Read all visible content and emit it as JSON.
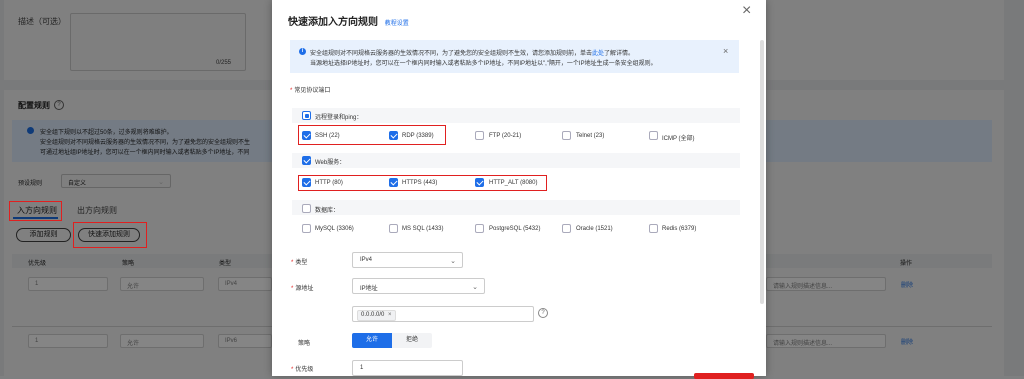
{
  "background": {
    "desc_label": "描述（可选）",
    "desc_counter": "0/255",
    "config_title": "配置规则",
    "info_lines": [
      "安全组下规则以不超过50条，过多规则将难维护。",
      "安全组规则对不同规格云服务器的生效情况不同，为了避免您的安全组规则不生",
      "可通过地址组IP地址时，您可以在一个框内同时输入或者粘贴多个IP地址，不同"
    ],
    "preset_label": "预设规则",
    "preset_value": "自定义",
    "tabs": [
      "入方向规则",
      "出方向规则"
    ],
    "add_rule": "添加规则",
    "quick_add_rule": "快速添加规则",
    "table_headers": [
      "优先级",
      "策略",
      "类型",
      "操作"
    ],
    "rows": [
      {
        "priority": "1",
        "policy": "允许",
        "type": "IPv4",
        "remark_placeholder": "请输入规则描述信息...",
        "action": "删除"
      },
      {
        "priority": "1",
        "policy": "允许",
        "type": "IPv6",
        "remark_placeholder": "请输入规则描述信息...",
        "action": "删除"
      }
    ]
  },
  "modal": {
    "title": "快速添加入方向规则",
    "title_link": "教程设置",
    "info": {
      "line1_prefix": "安全组规则对不同规格云服务器的生效情况不同，为了避免您的安全组规则不生效，请您添加规则前，单击",
      "line1_link": "此处",
      "line1_suffix": "了解详情。",
      "line2": "当源地址选择IP地址时，您可以在一个框内同时输入或者粘贴多个IP地址，不同IP地址以\",\"隔开，一个IP地址生成一条安全组规则。"
    },
    "protocols_label": "常见协议端口",
    "groups": [
      {
        "name": "远程登录和ping：",
        "items": [
          {
            "label": "SSH (22)",
            "checked": true
          },
          {
            "label": "RDP (3389)",
            "checked": true
          },
          {
            "label": "FTP (20-21)",
            "checked": false
          },
          {
            "label": "Telnet (23)",
            "checked": false
          },
          {
            "label": "ICMP (全部)",
            "checked": false
          }
        ]
      },
      {
        "name": "Web服务：",
        "items": [
          {
            "label": "HTTP (80)",
            "checked": true
          },
          {
            "label": "HTTPS (443)",
            "checked": true
          },
          {
            "label": "HTTP_ALT (8080)",
            "checked": true
          }
        ]
      },
      {
        "name": "数据库：",
        "items": [
          {
            "label": "MySQL (3306)",
            "checked": false
          },
          {
            "label": "MS SQL (1433)",
            "checked": false
          },
          {
            "label": "PostgreSQL (5432)",
            "checked": false
          },
          {
            "label": "Oracle (1521)",
            "checked": false
          },
          {
            "label": "Redis (6379)",
            "checked": false
          }
        ]
      }
    ],
    "type_label": "类型",
    "type_value": "IPv4",
    "source_label": "源地址",
    "source_value": "IP地址",
    "ip_tag": "0.0.0.0/0",
    "policy_label": "策略",
    "policy_allow": "允许",
    "policy_deny": "拒绝",
    "priority_label": "优先级",
    "priority_value": "1",
    "colors": {
      "accent": "#1e6ee8",
      "highlight": "#e02020",
      "info_bg": "#e8f1fd"
    }
  }
}
